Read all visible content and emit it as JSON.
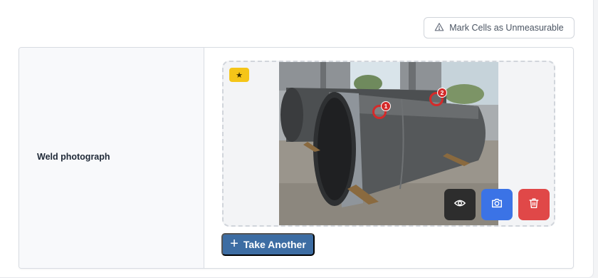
{
  "toolbar": {
    "mark_unmeasurable_label": "Mark Cells as Unmeasurable",
    "mark_unmeasurable_icon": "warning-triangle-icon"
  },
  "row": {
    "label": "Weld photograph",
    "photo": {
      "badge_icon": "star-icon",
      "badge_glyph": "★",
      "markers": [
        {
          "number": "1"
        },
        {
          "number": "2"
        }
      ]
    },
    "actions": {
      "view_icon": "eye-icon",
      "camera_icon": "camera-icon",
      "delete_icon": "trash-icon"
    },
    "take_another_label": "Take Another",
    "take_another_icon": "plus-icon"
  },
  "colors": {
    "take_another_bg": "#3d6da3",
    "camera_bg": "#3b73e6",
    "delete_bg": "#e04848",
    "view_bg": "#2d2d2d",
    "badge_bg": "#f5c518",
    "marker": "#d42a2a"
  }
}
